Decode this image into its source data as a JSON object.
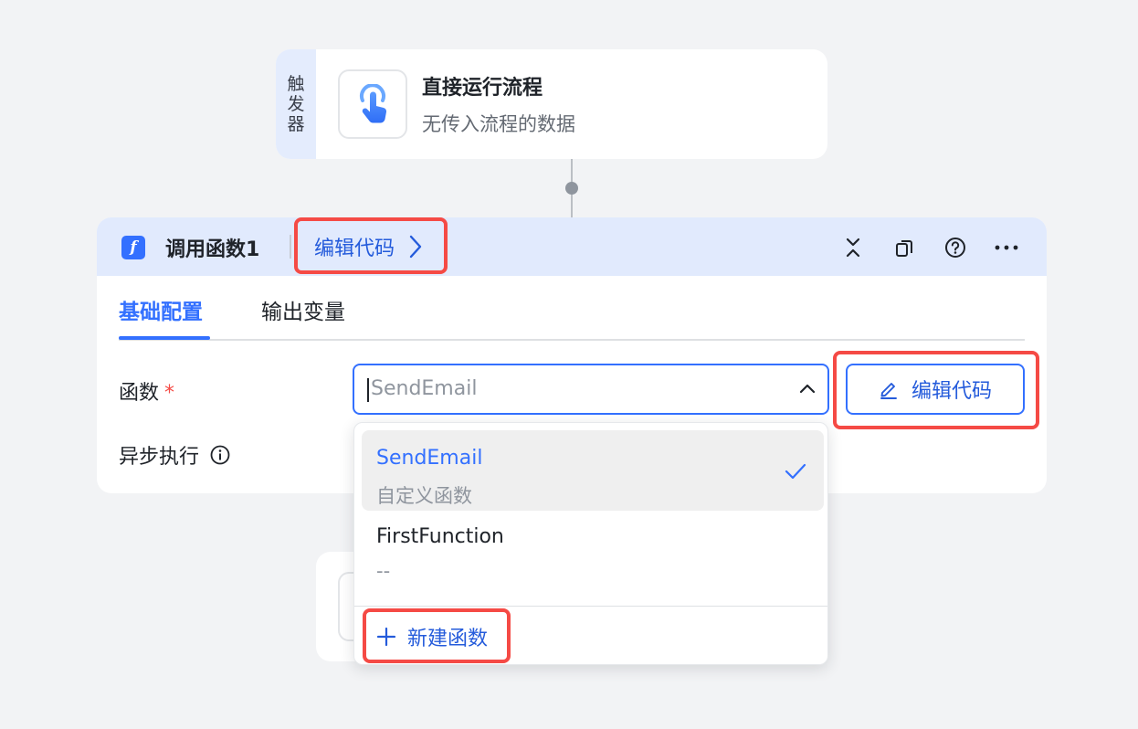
{
  "trigger": {
    "tag": [
      "触",
      "发",
      "器"
    ],
    "title": "直接运行流程",
    "subtitle": "无传入流程的数据",
    "icon": "touch-hand-icon"
  },
  "node": {
    "icon_letter": "f",
    "title": "调用函数1",
    "edit_code_link": "编辑代码",
    "header_icons": [
      "collapse-icon",
      "copy-icon",
      "help-icon",
      "more-icon"
    ],
    "tabs": [
      {
        "label": "基础配置",
        "active": true
      },
      {
        "label": "输出变量",
        "active": false
      }
    ],
    "function_label": "函数",
    "required_mark": "*",
    "async_label": "异步执行",
    "select": {
      "placeholder": "SendEmail"
    },
    "edit_code_button": "编辑代码"
  },
  "dropdown": {
    "options": [
      {
        "name": "SendEmail",
        "subtitle": "自定义函数",
        "selected": true
      },
      {
        "name": "FirstFunction",
        "subtitle": "--",
        "selected": false
      }
    ],
    "new_function": "新建函数"
  },
  "colors": {
    "accent": "#3370ff",
    "highlight": "#f54a45",
    "header_bg": "#e1eafd",
    "page_bg": "#f2f3f5"
  }
}
